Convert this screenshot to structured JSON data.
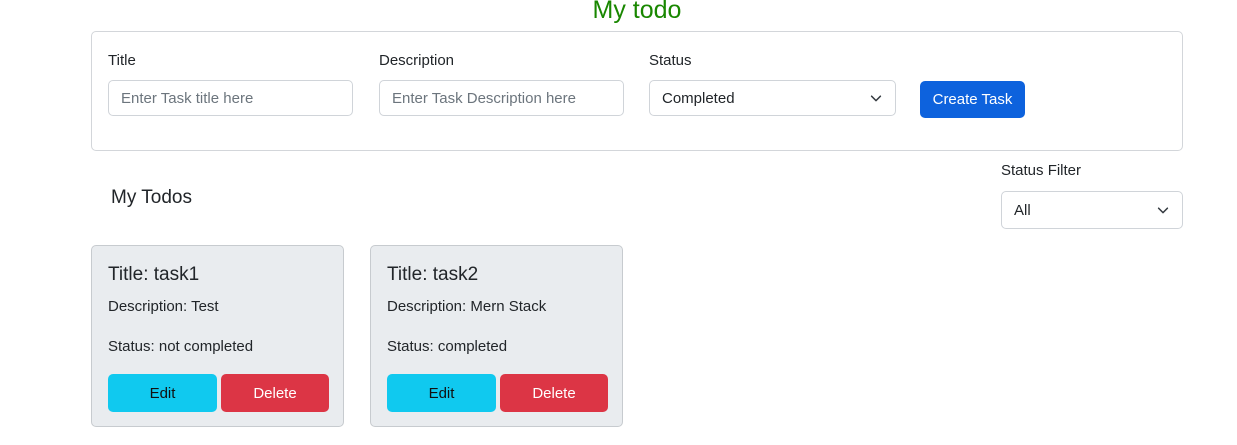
{
  "app": {
    "title": "My todo"
  },
  "form": {
    "title_label": "Title",
    "title_placeholder": "Enter Task title here",
    "title_value": "",
    "description_label": "Description",
    "description_placeholder": "Enter Task Description here",
    "description_value": "",
    "status_label": "Status",
    "status_value": "Completed",
    "create_label": "Create Task"
  },
  "list": {
    "heading": "My Todos",
    "filter_label": "Status Filter",
    "filter_value": "All"
  },
  "todos": [
    {
      "title": "Title: task1",
      "description": "Description: Test",
      "status": "Status: not completed",
      "edit_label": "Edit",
      "delete_label": "Delete"
    },
    {
      "title": "Title: task2",
      "description": "Description: Mern Stack",
      "status": "Status: completed",
      "edit_label": "Edit",
      "delete_label": "Delete"
    }
  ],
  "colors": {
    "title_green": "#198700",
    "primary": "#0d62dd",
    "info": "#10c9ef",
    "danger": "#dc3545",
    "card_bg": "#e9ecef"
  },
  "icons": {
    "select_arrow": "chevron-down-icon"
  }
}
